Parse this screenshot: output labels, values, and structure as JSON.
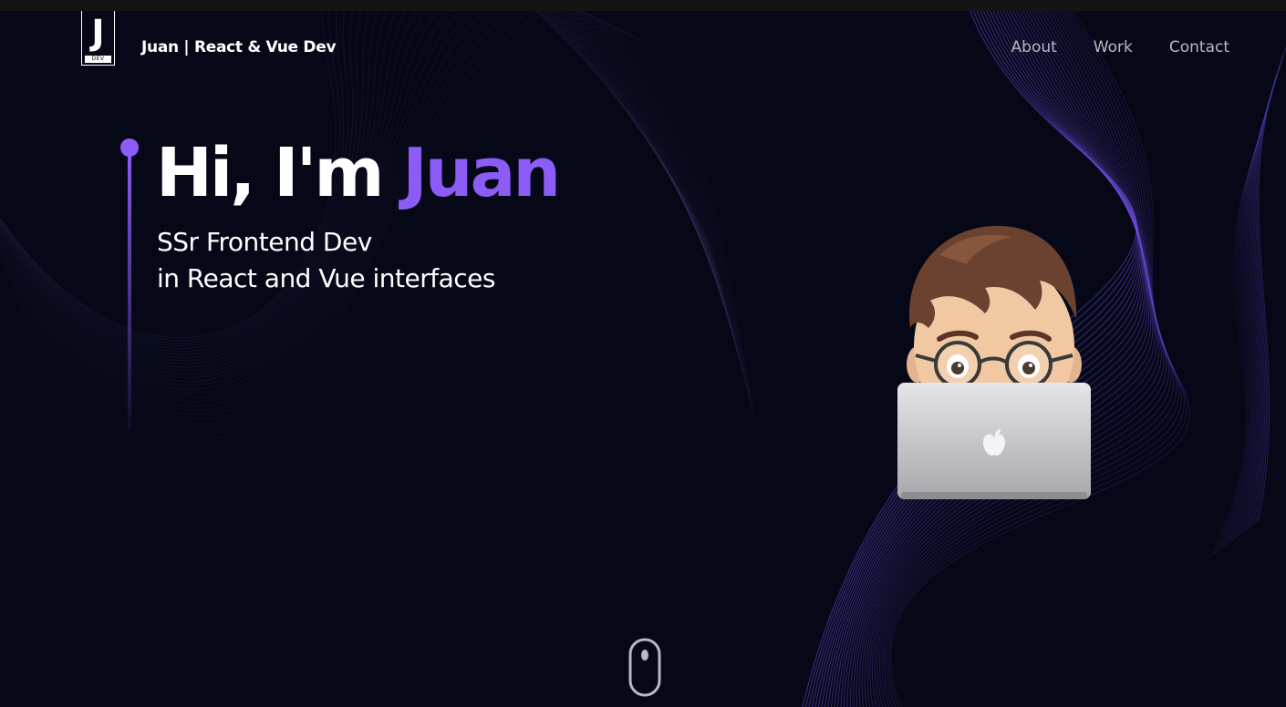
{
  "header": {
    "logo_letter": "J",
    "logo_tag": "DEV",
    "brand": "Juan  | React & Vue Dev"
  },
  "nav": {
    "items": [
      {
        "label": "About"
      },
      {
        "label": "Work"
      },
      {
        "label": "Contact"
      }
    ]
  },
  "hero": {
    "greeting": "Hi, I'm ",
    "name": "Juan",
    "subtitle_line1": "SSr Frontend Dev",
    "subtitle_line2": "in React and Vue interfaces"
  },
  "colors": {
    "background": "#060817",
    "accent": "#8b5cf6",
    "nav_text": "#b7b9c9",
    "text": "#ffffff"
  },
  "icons": {
    "avatar": "memoji-avatar-with-laptop",
    "laptop_logo": "apple-logo-icon",
    "scroll": "mouse-scroll-icon"
  }
}
